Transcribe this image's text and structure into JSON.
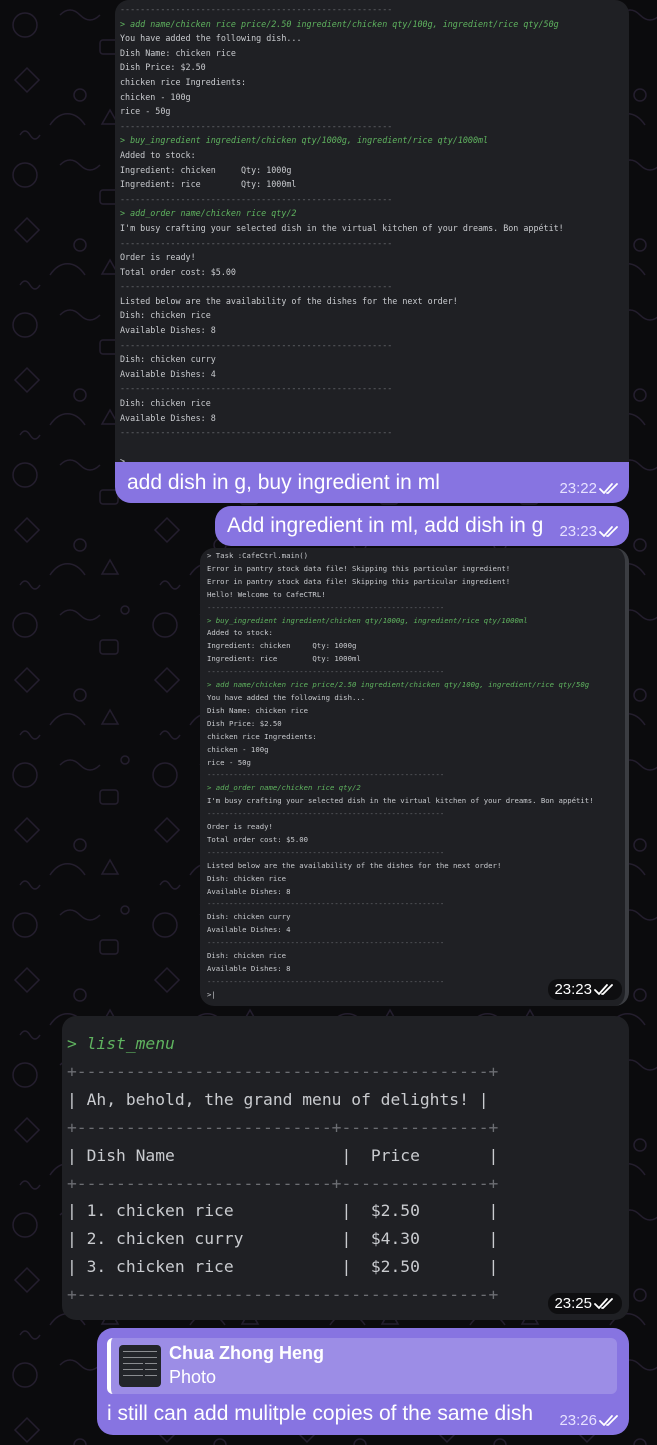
{
  "terminal1": {
    "lines": [
      {
        "t": "------------------------------------------------------",
        "k": "sep"
      },
      {
        "t": "> add name/chicken rice price/2.50 ingredient/chicken qty/100g, ingredient/rice qty/50g",
        "k": "cmd"
      },
      {
        "t": "You have added the following dish...",
        "k": ""
      },
      {
        "t": "Dish Name: chicken rice",
        "k": ""
      },
      {
        "t": "Dish Price: $2.50",
        "k": ""
      },
      {
        "t": "chicken rice Ingredients:",
        "k": ""
      },
      {
        "t": "chicken - 100g",
        "k": ""
      },
      {
        "t": "rice - 50g",
        "k": ""
      },
      {
        "t": "------------------------------------------------------",
        "k": "sep"
      },
      {
        "t": "> buy_ingredient ingredient/chicken qty/1000g, ingredient/rice qty/1000ml",
        "k": "cmd"
      },
      {
        "t": "Added to stock:",
        "k": ""
      },
      {
        "t": "Ingredient: chicken     Qty: 1000g",
        "k": ""
      },
      {
        "t": "Ingredient: rice        Qty: 1000ml",
        "k": ""
      },
      {
        "t": "------------------------------------------------------",
        "k": "sep"
      },
      {
        "t": "> add_order name/chicken rice qty/2",
        "k": "cmd"
      },
      {
        "t": "I'm busy crafting your selected dish in the virtual kitchen of your dreams. Bon appétit!",
        "k": ""
      },
      {
        "t": "------------------------------------------------------",
        "k": "sep"
      },
      {
        "t": "Order is ready!",
        "k": ""
      },
      {
        "t": "Total order cost: $5.00",
        "k": ""
      },
      {
        "t": "------------------------------------------------------",
        "k": "sep"
      },
      {
        "t": "Listed below are the availability of the dishes for the next order!",
        "k": ""
      },
      {
        "t": "Dish: chicken rice",
        "k": ""
      },
      {
        "t": "Available Dishes: 8",
        "k": ""
      },
      {
        "t": "------------------------------------------------------",
        "k": "sep"
      },
      {
        "t": "Dish: chicken curry",
        "k": ""
      },
      {
        "t": "Available Dishes: 4",
        "k": ""
      },
      {
        "t": "------------------------------------------------------",
        "k": "sep"
      },
      {
        "t": "Dish: chicken rice",
        "k": ""
      },
      {
        "t": "Available Dishes: 8",
        "k": ""
      },
      {
        "t": "------------------------------------------------------",
        "k": "sep"
      },
      {
        "t": "",
        "k": ""
      },
      {
        "t": ">",
        "k": ""
      }
    ],
    "caption": "add dish in g, buy ingredient in ml",
    "time": "23:22"
  },
  "message2": {
    "text": "Add ingredient in ml, add dish in g",
    "time": "23:23"
  },
  "terminal2": {
    "lines": [
      {
        "t": "> Task :CafeCtrl.main()",
        "k": ""
      },
      {
        "t": "Error in pantry stock data file! Skipping this particular ingredient!",
        "k": ""
      },
      {
        "t": "Error in pantry stock data file! Skipping this particular ingredient!",
        "k": ""
      },
      {
        "t": "Hello! Welcome to CafeCTRL!",
        "k": ""
      },
      {
        "t": "------------------------------------------------------",
        "k": "sep"
      },
      {
        "t": "> buy_ingredient ingredient/chicken qty/1000g, ingredient/rice qty/1000ml",
        "k": "cmd"
      },
      {
        "t": "Added to stock:",
        "k": ""
      },
      {
        "t": "Ingredient: chicken     Qty: 1000g",
        "k": ""
      },
      {
        "t": "Ingredient: rice        Qty: 1000ml",
        "k": ""
      },
      {
        "t": "------------------------------------------------------",
        "k": "sep"
      },
      {
        "t": "> add name/chicken rice price/2.50 ingredient/chicken qty/100g, ingredient/rice qty/50g",
        "k": "cmd"
      },
      {
        "t": "You have added the following dish...",
        "k": ""
      },
      {
        "t": "Dish Name: chicken rice",
        "k": ""
      },
      {
        "t": "Dish Price: $2.50",
        "k": ""
      },
      {
        "t": "chicken rice Ingredients:",
        "k": ""
      },
      {
        "t": "chicken - 100g",
        "k": ""
      },
      {
        "t": "rice - 50g",
        "k": ""
      },
      {
        "t": "------------------------------------------------------",
        "k": "sep"
      },
      {
        "t": "> add_order name/chicken rice qty/2",
        "k": "cmd"
      },
      {
        "t": "I'm busy crafting your selected dish in the virtual kitchen of your dreams. Bon appétit!",
        "k": ""
      },
      {
        "t": "------------------------------------------------------",
        "k": "sep"
      },
      {
        "t": "Order is ready!",
        "k": ""
      },
      {
        "t": "Total order cost: $5.00",
        "k": ""
      },
      {
        "t": "------------------------------------------------------",
        "k": "sep"
      },
      {
        "t": "Listed below are the availability of the dishes for the next order!",
        "k": ""
      },
      {
        "t": "Dish: chicken rice",
        "k": ""
      },
      {
        "t": "Available Dishes: 8",
        "k": ""
      },
      {
        "t": "------------------------------------------------------",
        "k": "sep"
      },
      {
        "t": "Dish: chicken curry",
        "k": ""
      },
      {
        "t": "Available Dishes: 4",
        "k": ""
      },
      {
        "t": "------------------------------------------------------",
        "k": "sep"
      },
      {
        "t": "Dish: chicken rice",
        "k": ""
      },
      {
        "t": "Available Dishes: 8",
        "k": ""
      },
      {
        "t": "------------------------------------------------------",
        "k": "sep"
      },
      {
        "t": ">|",
        "k": ""
      }
    ],
    "time": "23:23"
  },
  "terminal3": {
    "lines": [
      {
        "t": "> list_menu",
        "k": "cmd"
      },
      {
        "t": "+------------------------------------------+",
        "k": "sep"
      },
      {
        "t": "| Ah, behold, the grand menu of delights! |",
        "k": ""
      },
      {
        "t": "+--------------------------+---------------+",
        "k": "sep"
      },
      {
        "t": "| Dish Name                 |  Price       |",
        "k": ""
      },
      {
        "t": "+--------------------------+---------------+",
        "k": "sep"
      },
      {
        "t": "| 1. chicken rice           |  $2.50       |",
        "k": ""
      },
      {
        "t": "| 2. chicken curry          |  $4.30       |",
        "k": ""
      },
      {
        "t": "| 3. chicken rice           |  $2.50       |",
        "k": ""
      },
      {
        "t": "+------------------------------------------+",
        "k": "sep"
      }
    ],
    "time": "23:25"
  },
  "message4": {
    "reply_author": "Chua Zhong Heng",
    "reply_type": "Photo",
    "text": "i still can add mulitple copies of the same dish",
    "time": "23:26"
  },
  "colors": {
    "accent": "#8774e1",
    "background": "#0b0b0d",
    "terminal_bg": "#1f2024",
    "command_green": "#5fb35f"
  }
}
